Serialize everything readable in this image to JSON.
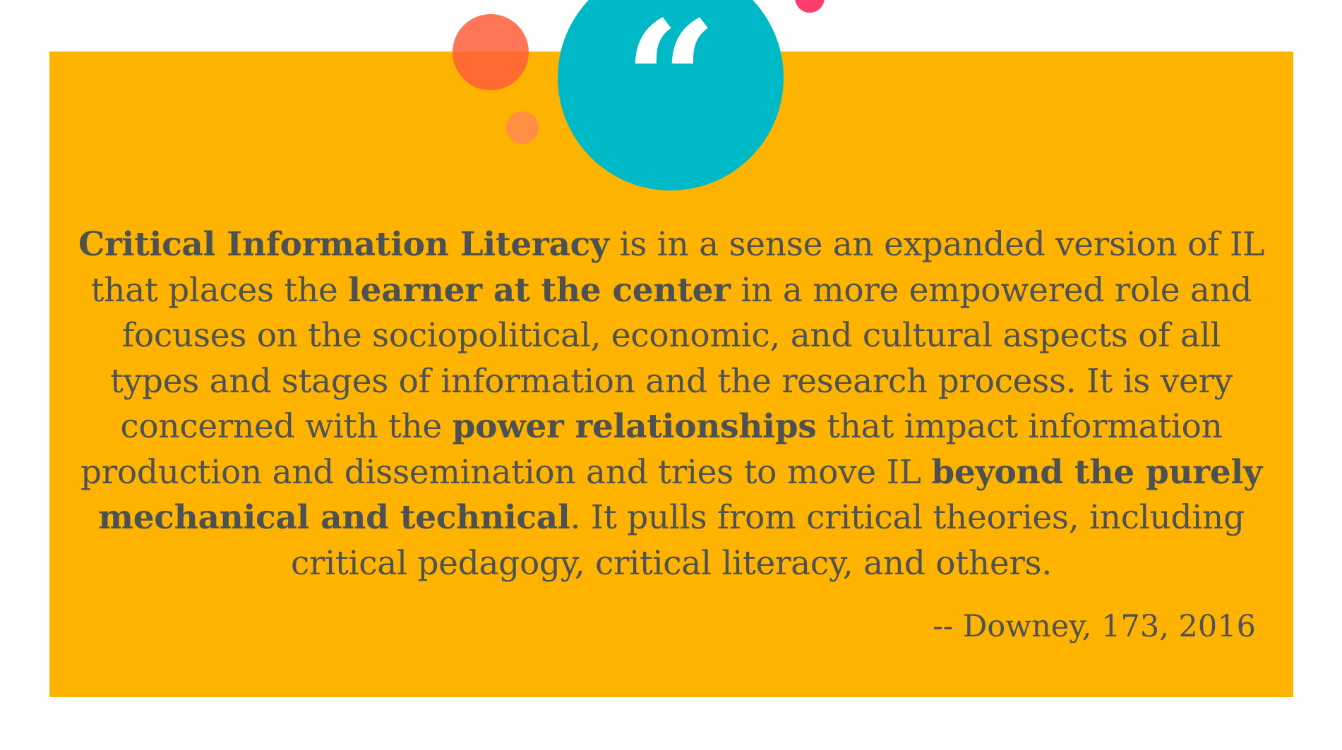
{
  "quote": {
    "mark": "“",
    "segments": [
      {
        "text": "Critical Information Literacy",
        "bold": true
      },
      {
        "text": " is in a sense an expanded version of IL that places the ",
        "bold": false
      },
      {
        "text": "learner at the center",
        "bold": true
      },
      {
        "text": " in a more empowered role and focuses on the sociopolitical, economic, and cultural aspects of all types and stages of information and the research process. It is very concerned with the ",
        "bold": false
      },
      {
        "text": "power relationships",
        "bold": true
      },
      {
        "text": " that impact information production and dissemination and tries to move IL ",
        "bold": false
      },
      {
        "text": "beyond the purely mechanical and technical",
        "bold": true
      },
      {
        "text": ". It pulls from critical theories, including critical pedagogy, critical literacy, and others.",
        "bold": false
      }
    ],
    "citation": "-- Downey, 173, 2016"
  },
  "colors": {
    "card_background": "#FDB300",
    "quote_circle": "#00B9C6",
    "text": "#4E5255",
    "accent_red": "#FF5E3A",
    "accent_orange": "#FF8A4C",
    "accent_pink": "#FF3D6A"
  },
  "icons": {
    "quote_mark": "quote-mark-icon"
  }
}
